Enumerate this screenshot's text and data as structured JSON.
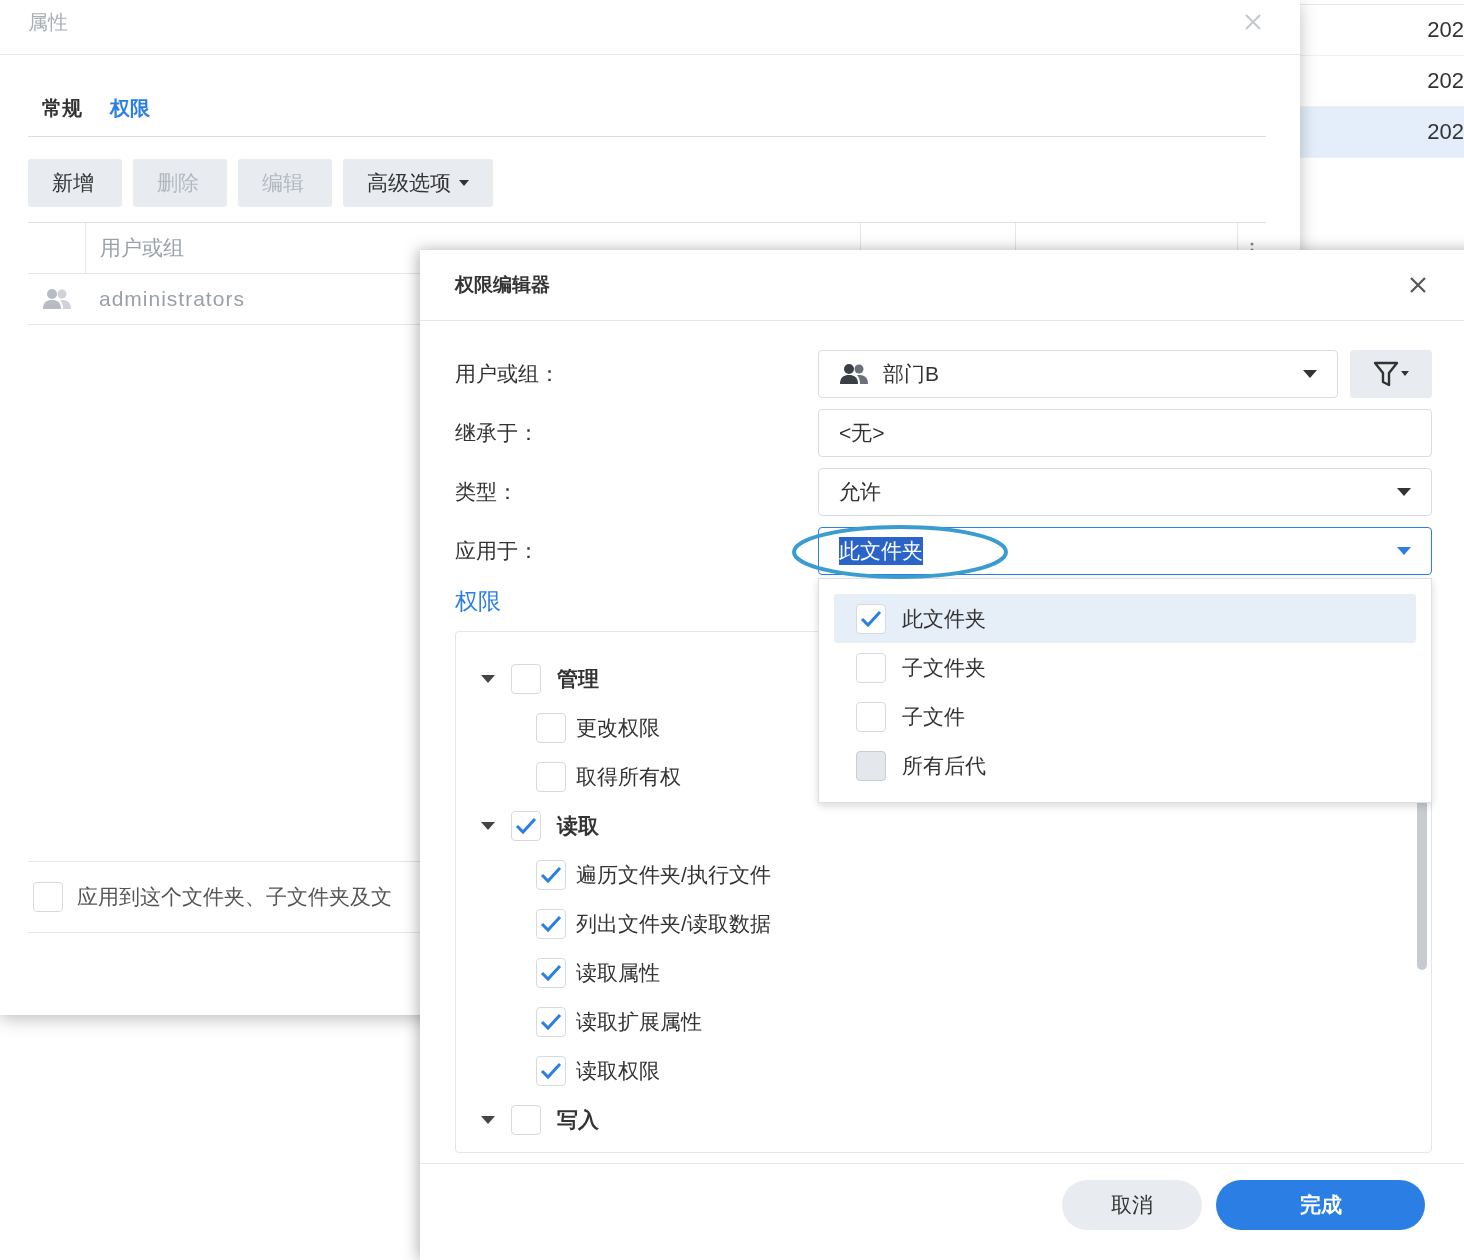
{
  "back_list": {
    "rows": [
      {
        "cell": "202",
        "selected": false
      },
      {
        "cell": "202",
        "selected": false
      },
      {
        "cell": "202",
        "selected": true
      }
    ]
  },
  "properties": {
    "title": "属性",
    "tabs": [
      {
        "label": "常规",
        "selected": false
      },
      {
        "label": "权限",
        "selected": true
      }
    ],
    "toolbar": [
      {
        "label": "新增",
        "disabled": false,
        "dropdown": false
      },
      {
        "label": "删除",
        "disabled": true,
        "dropdown": false
      },
      {
        "label": "编辑",
        "disabled": true,
        "dropdown": false
      },
      {
        "label": "高级选项",
        "disabled": false,
        "dropdown": true
      }
    ],
    "table": {
      "columns": [
        "用户或组"
      ],
      "rows": [
        {
          "name": "administrators"
        }
      ]
    },
    "apply_option": {
      "label": "应用到这个文件夹、子文件夹及文",
      "checked": false
    }
  },
  "editor": {
    "title": "权限编辑器",
    "fields": [
      {
        "label": "用户或组：",
        "value": "部门B",
        "kind": "group-select"
      },
      {
        "label": "继承于：",
        "value": "<无>",
        "kind": "text"
      },
      {
        "label": "类型：",
        "value": "允许",
        "kind": "select"
      },
      {
        "label": "应用于：",
        "value": "此文件夹",
        "kind": "select",
        "focused": true,
        "value_selected": true
      }
    ],
    "section": "权限",
    "permissions": [
      {
        "label": "管理",
        "checked": false,
        "expanded": true,
        "children": [
          {
            "label": "更改权限",
            "checked": false
          },
          {
            "label": "取得所有权",
            "checked": false
          }
        ]
      },
      {
        "label": "读取",
        "checked": true,
        "expanded": true,
        "children": [
          {
            "label": "遍历文件夹/执行文件",
            "checked": true
          },
          {
            "label": "列出文件夹/读取数据",
            "checked": true
          },
          {
            "label": "读取属性",
            "checked": true
          },
          {
            "label": "读取扩展属性",
            "checked": true
          },
          {
            "label": "读取权限",
            "checked": true
          }
        ]
      },
      {
        "label": "写入",
        "checked": false,
        "expanded": true
      }
    ],
    "apply_menu": [
      {
        "label": "此文件夹",
        "checked": true,
        "selected": true,
        "disabled": false
      },
      {
        "label": "子文件夹",
        "checked": false,
        "selected": false,
        "disabled": false
      },
      {
        "label": "子文件",
        "checked": false,
        "selected": false,
        "disabled": false
      },
      {
        "label": "所有后代",
        "checked": false,
        "selected": false,
        "disabled": true
      }
    ],
    "buttons": [
      {
        "label": "取消",
        "kind": "secondary"
      },
      {
        "label": "完成",
        "kind": "primary"
      }
    ]
  }
}
